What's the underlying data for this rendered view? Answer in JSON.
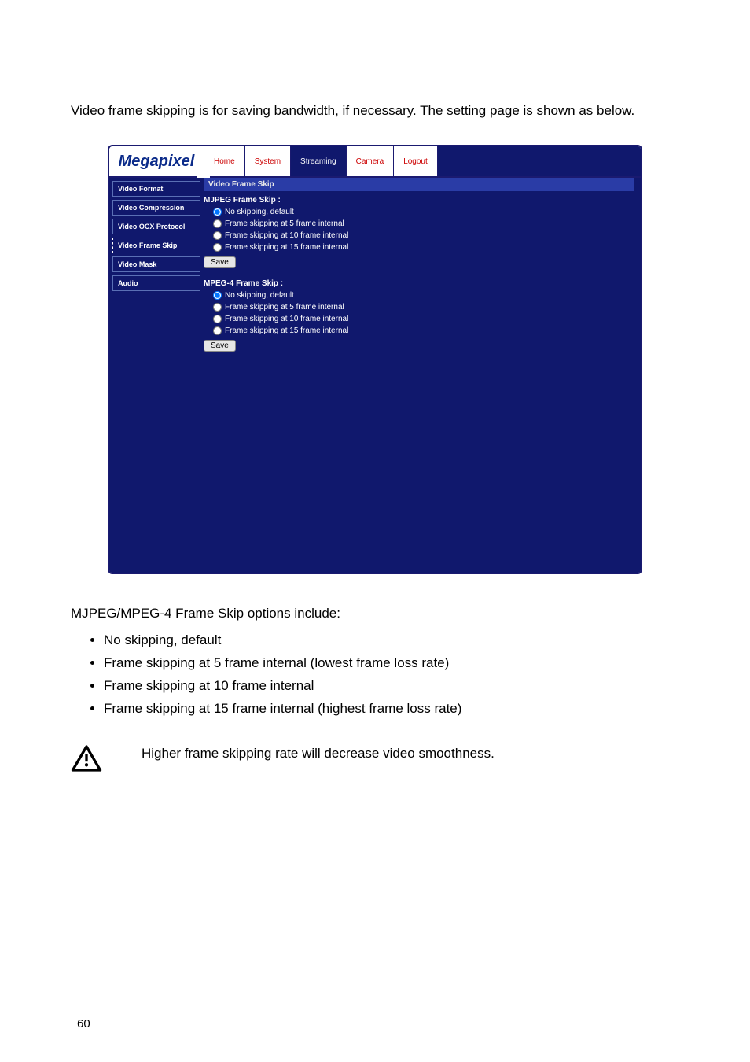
{
  "intro": "Video frame skipping is for saving bandwidth, if necessary. The setting page is shown as below.",
  "app": {
    "logo": "Megapixel",
    "tabs": {
      "home": "Home",
      "system": "System",
      "streaming": "Streaming",
      "camera": "Camera",
      "logout": "Logout"
    },
    "sidebar": {
      "video_format": "Video Format",
      "video_compression": "Video Compression",
      "video_ocx": "Video OCX Protocol",
      "video_frame_skip": "Video Frame Skip",
      "video_mask": "Video Mask",
      "audio": "Audio"
    },
    "panel": {
      "title": "Video Frame Skip",
      "mjpeg_title": "MJPEG Frame Skip :",
      "mpeg4_title": "MPEG-4 Frame Skip :",
      "opt_none": "No skipping, default",
      "opt_5": "Frame skipping at 5 frame internal",
      "opt_10": "Frame skipping at 10 frame internal",
      "opt_15": "Frame skipping at 15 frame internal",
      "save": "Save"
    }
  },
  "options_intro": "MJPEG/MPEG-4 Frame Skip options include:",
  "options": {
    "o1": "No skipping, default",
    "o2": "Frame skipping at 5 frame internal (lowest frame loss rate)",
    "o3": "Frame skipping at 10 frame internal",
    "o4": "Frame skipping at 15 frame internal (highest frame loss rate)"
  },
  "note": "Higher frame skipping rate will decrease video smoothness.",
  "page_number": "60"
}
